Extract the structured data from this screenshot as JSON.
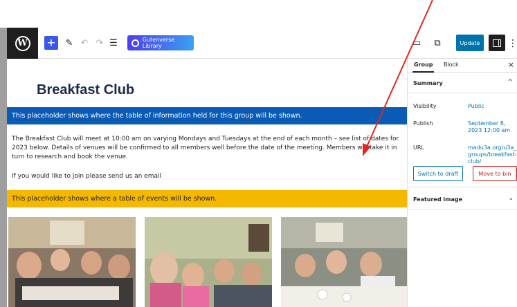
{
  "toolbar": {
    "logo": "W",
    "add_icon": "+",
    "pen_icon": "✎",
    "undo_icon": "↶",
    "redo_icon": "↷",
    "outline_icon": "☰",
    "gutenverse_label": "Gutenverse Library",
    "view_icon": "▭",
    "external_icon": "⧉",
    "update_label": "Update",
    "more_icon": "⋮"
  },
  "content": {
    "title": "Breakfast Club",
    "info_placeholder": "This placeholder shows where the table of information held for this group will be shown.",
    "description": "The Breakfast Club will meet at 10:00 am on varying Mondays and Tuesdays at the end of each month – see list of dates for 2023 below. Details of venues will be confirmed to all members well before the date of the meeting.  Members will take it in turn to research and book the venue.",
    "join_text": "If you would like to join please send us an email",
    "events_placeholder": "This placeholder shows where a table of events will be shown."
  },
  "sidebar": {
    "tab_group": "Group",
    "tab_block": "Block",
    "close": "×",
    "summary_label": "Summary",
    "summary_chevron": "^",
    "visibility_label": "Visibility",
    "visibility_value": "Public",
    "publish_label": "Publish",
    "publish_value": "September 8, 2023 12:00 am",
    "url_label": "URL",
    "url_value": "madu3a.org/u3a_ groups/breakfast- club/",
    "switch_draft": "Switch to draft",
    "move_bin": "Move to bin",
    "featured_label": "Featured image",
    "featured_chevron": "⌄"
  },
  "colors": {
    "info_bar": "#0a5bb5",
    "events_bar": "#f5b800",
    "update_button": "#0073aa",
    "annotation_arrow": "#e0281e"
  }
}
